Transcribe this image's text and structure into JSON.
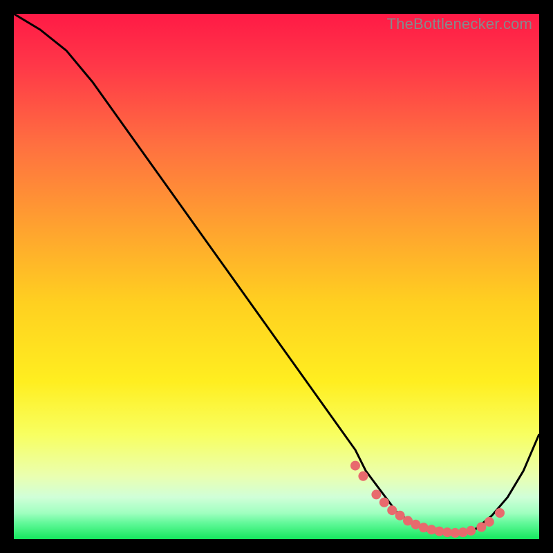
{
  "watermark": "TheBottlenecker.com",
  "colors": {
    "bg": "#000000",
    "top": "#ff1a46",
    "mid": "#ffe400",
    "green": "#15e85e",
    "line": "#000000",
    "dot": "#e86a6d"
  },
  "chart_data": {
    "type": "line",
    "xlabel": "",
    "ylabel": "",
    "xlim": [
      0,
      100
    ],
    "ylim": [
      0,
      100
    ],
    "title": "",
    "series": [
      {
        "name": "bottleneck-curve",
        "x": [
          0,
          5,
          10,
          15,
          20,
          25,
          30,
          35,
          40,
          45,
          50,
          55,
          60,
          65,
          67,
          70,
          73,
          76,
          79,
          82,
          85,
          88,
          91,
          94,
          97,
          100
        ],
        "y": [
          100,
          97,
          93,
          87,
          80,
          73,
          66,
          59,
          52,
          45,
          38,
          31,
          24,
          17,
          13,
          9,
          5,
          3,
          1.5,
          1,
          1,
          2,
          4.5,
          8,
          13,
          20
        ]
      }
    ],
    "markers": {
      "name": "valley-dots",
      "x": [
        65,
        66.5,
        69,
        70.5,
        72,
        73.5,
        75,
        76.5,
        78,
        79.5,
        81,
        82.5,
        84,
        85.5,
        87,
        89,
        90.5,
        92.5
      ],
      "y": [
        14,
        12,
        8.5,
        7,
        5.5,
        4.5,
        3.5,
        2.8,
        2.2,
        1.8,
        1.5,
        1.3,
        1.2,
        1.3,
        1.6,
        2.3,
        3.3,
        5
      ]
    }
  }
}
